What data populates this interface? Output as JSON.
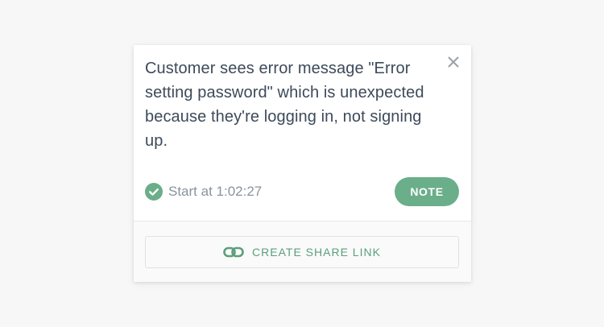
{
  "note": {
    "text": "Customer sees error message \"Error setting password\" which is unexpected because they're logging in, not signing up.",
    "timestamp": "Start at 1:02:27",
    "note_button_label": "NOTE",
    "share_button_label": "CREATE SHARE LINK"
  },
  "icons": {
    "close": "close-icon",
    "check": "check-circle-icon",
    "link": "link-icon"
  },
  "colors": {
    "accent": "#6aae8a",
    "share_text": "#5c9f7c",
    "body_text": "#3d4a5a",
    "muted_text": "#8a939c"
  }
}
